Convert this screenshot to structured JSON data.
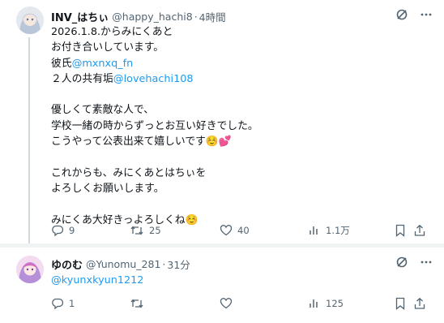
{
  "tweet": {
    "name": "INV_はちぃ",
    "handle": "@happy_hachi8",
    "separator": "·",
    "time": "4時間",
    "lines": [
      {
        "text": "2026.1.8.からみにくあと"
      },
      {
        "text": "お付き合いしています。"
      },
      {
        "text": "彼氏",
        "mention": "@mxnxq_fn"
      },
      {
        "text": "２人の共有垢",
        "mention": "@lovehachi108"
      },
      {
        "blank": true
      },
      {
        "text": "優しくて素敵な人で、"
      },
      {
        "text": "学校一緒の時からずっとお互い好きでした。"
      },
      {
        "text": "こうやって公表出来て嬉しいです☺️💕"
      },
      {
        "blank": true
      },
      {
        "text": "これからも、みにくあとはちぃを"
      },
      {
        "text": "よろしくお願いします。"
      },
      {
        "blank": true
      },
      {
        "text": "みにくあ大好きっよろしくね☺️"
      }
    ],
    "actions": {
      "replies": "9",
      "reposts": "25",
      "likes": "40",
      "views": "1.1万"
    }
  },
  "reply": {
    "name": "ゆのむ",
    "handle": "@Yunomu_281",
    "separator": "·",
    "time": "31分",
    "mention": "@kyunxkyun1212",
    "actions": {
      "replies": "1",
      "reposts": "",
      "likes": "",
      "views": "125"
    }
  },
  "icons": {
    "header": [
      "grok-icon",
      "more-icon"
    ],
    "actions": [
      "reply-icon",
      "repost-icon",
      "like-icon",
      "views-icon",
      "bookmark-icon",
      "share-icon"
    ]
  },
  "colors": {
    "mention": "#1d9bf0",
    "secondary_text": "#536471",
    "separator": "#eff3f4"
  }
}
